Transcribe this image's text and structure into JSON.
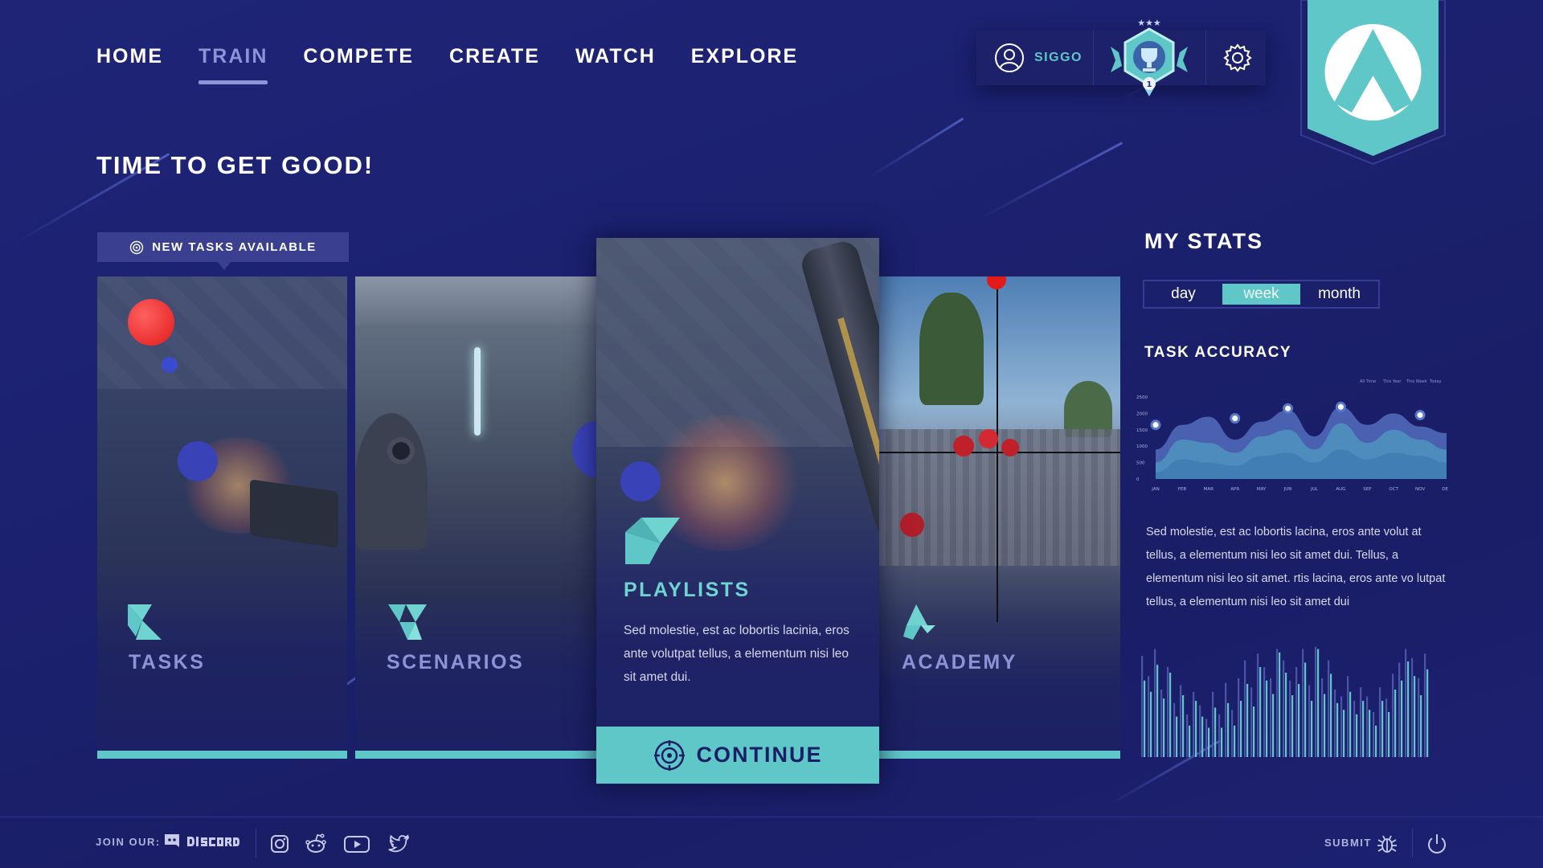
{
  "nav": {
    "items": [
      {
        "label": "HOME",
        "active": false
      },
      {
        "label": "TRAIN",
        "active": true
      },
      {
        "label": "COMPETE",
        "active": false
      },
      {
        "label": "CREATE",
        "active": false
      },
      {
        "label": "WATCH",
        "active": false
      },
      {
        "label": "EXPLORE",
        "active": false
      }
    ]
  },
  "user": {
    "name": "SIGGO",
    "icon": "user-icon",
    "rank_badge": "rank-badge-icon",
    "rank_number": "1"
  },
  "settings_icon": "gear-icon",
  "hero": {
    "title": "TIME TO GET GOOD!"
  },
  "tasks_tag": {
    "label": "NEW TASKS AVAILABLE",
    "icon": "target-icon"
  },
  "cards": {
    "tasks": {
      "label": "TASKS"
    },
    "scenarios": {
      "label": "SCENARIOS"
    },
    "playlists": {
      "label": "PLAYLISTS",
      "description": "Sed molestie, est ac lobortis lacinia, eros ante volutpat tellus, a elementum nisi leo sit amet dui."
    },
    "academy": {
      "label": "ACADEMY"
    }
  },
  "continue_button": {
    "label": "CONTINUE",
    "icon": "crosshair-icon"
  },
  "stats": {
    "title": "MY STATS",
    "periods": [
      {
        "label": "day",
        "selected": false
      },
      {
        "label": "week",
        "selected": true
      },
      {
        "label": "month",
        "selected": false
      }
    ],
    "accuracy_title": "TASK ACCURACY",
    "description": "Sed molestie, est ac lobortis lacina, eros ante volut at tellus, a elementum nisi leo sit amet dui. Tellus, a elementum nisi leo sit amet. rtis lacina, eros ante vo lutpat tellus, a elementum nisi leo sit amet dui"
  },
  "chart_data": [
    {
      "type": "area",
      "y_ticks": [
        "2500",
        "2000",
        "1500",
        "1000",
        "500",
        "0"
      ],
      "ylim": [
        0,
        2500
      ],
      "categories": [
        "JAN",
        "FEB",
        "MAR",
        "APR",
        "MAY",
        "JUN",
        "JUL",
        "AUG",
        "SEP",
        "OCT",
        "NOV",
        "DEC"
      ],
      "legend": [
        "All Time",
        "This Year",
        "This Week",
        "Today"
      ],
      "series": [
        {
          "values": [
            900,
            1650,
            1900,
            1200,
            1750,
            2100,
            1300,
            2200,
            1650,
            2000,
            1600,
            1400
          ]
        },
        {
          "values": [
            500,
            1200,
            1100,
            800,
            1300,
            1500,
            900,
            1700,
            1100,
            1500,
            1200,
            900
          ]
        },
        {
          "values": [
            200,
            600,
            500,
            400,
            700,
            800,
            500,
            900,
            600,
            800,
            700,
            500
          ]
        }
      ],
      "markers": [
        {
          "x": "JAN",
          "y": 1650
        },
        {
          "x": "APR",
          "y": 1850
        },
        {
          "x": "JUN",
          "y": 2150
        },
        {
          "x": "AUG",
          "y": 2200
        },
        {
          "x": "NOV",
          "y": 1950
        }
      ]
    },
    {
      "type": "bar",
      "series": [
        {
          "values": [
            68,
            58,
            82,
            52,
            75,
            36,
            55,
            28,
            50,
            36,
            26,
            44,
            26,
            48,
            28,
            50,
            65,
            45,
            80,
            68,
            56,
            93,
            75,
            55,
            65,
            84,
            50,
            96,
            56,
            74,
            48,
            42,
            58,
            38,
            50,
            42,
            28,
            50,
            40,
            60,
            68,
            85,
            72,
            55,
            78
          ]
        },
        {
          "values": [
            90,
            72,
            96,
            60,
            80,
            48,
            64,
            38,
            58,
            46,
            34,
            58,
            38,
            66,
            42,
            70,
            86,
            62,
            92,
            80,
            70,
            96,
            86,
            68,
            80,
            96,
            64,
            98,
            70,
            86,
            60,
            54,
            72,
            50,
            62,
            54,
            40,
            62,
            52,
            74,
            84,
            96,
            88,
            70,
            92
          ]
        }
      ]
    }
  ]
}
